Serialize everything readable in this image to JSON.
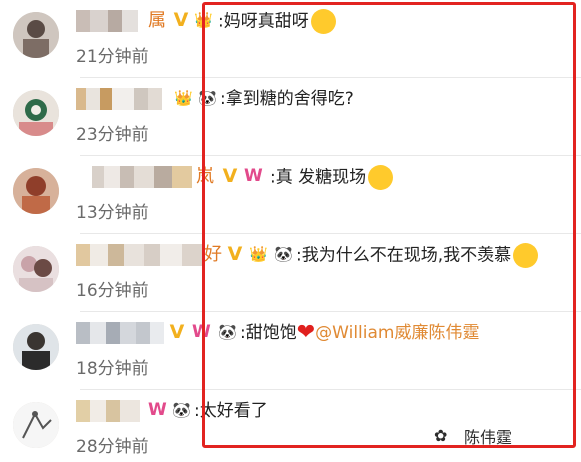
{
  "comments": [
    {
      "name_suffix": "属",
      "badges": [
        "v",
        "crown"
      ],
      "text": ":妈呀真甜呀",
      "time": "21分钟前",
      "emoji": "grin"
    },
    {
      "name_suffix": "",
      "badges": [
        "crown",
        "panda"
      ],
      "text": ":拿到糖的舍得吃?",
      "time": "23分钟前"
    },
    {
      "name_suffix": "岚",
      "badges": [
        "v",
        "w"
      ],
      "text": ":真 发糖现场",
      "time": "13分钟前",
      "emoji": "shy"
    },
    {
      "name_suffix": "好",
      "badges": [
        "v",
        "crown",
        "panda"
      ],
      "text": ":我为什么不在现场,我不羡慕",
      "time": "16分钟前",
      "emoji": "wow"
    },
    {
      "name_suffix": "",
      "badges": [
        "v",
        "w",
        "panda"
      ],
      "text": ":甜饱饱",
      "mention": "@William威廉陈伟霆",
      "time": "18分钟前"
    },
    {
      "name_suffix": "",
      "badges": [
        "w",
        "panda"
      ],
      "text": ":太好看了",
      "time": "28分钟前"
    }
  ],
  "brand": {
    "name": "陈伟霆",
    "icon": "wechat-icon"
  },
  "colors": {
    "highlight_box": "#e22320",
    "mention": "#e08a34",
    "time": "#6a6a6a"
  }
}
